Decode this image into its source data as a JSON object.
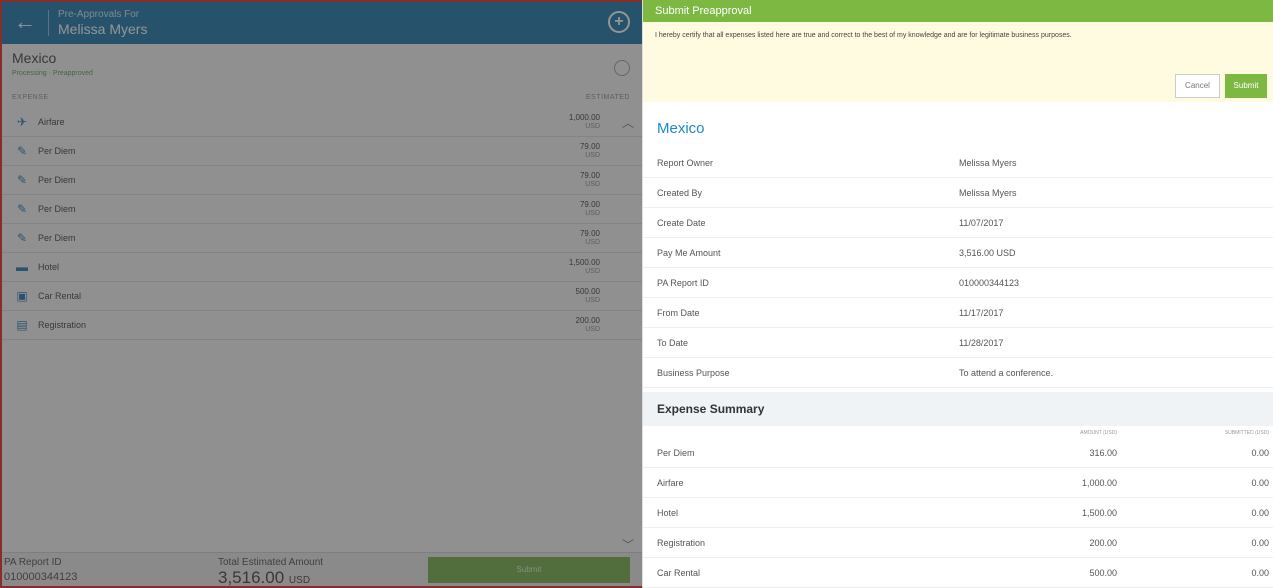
{
  "left": {
    "header": {
      "pre_label": "Pre-Approvals For",
      "name": "Melissa Myers"
    },
    "report": {
      "title": "Mexico",
      "status": "Processing · Preapproved"
    },
    "columns": {
      "expense": "EXPENSE",
      "estimated": "ESTIMATED"
    },
    "rows": [
      {
        "icon": "airplane-icon",
        "glyph": "✈",
        "label": "Airfare",
        "amount": "1,000.00",
        "currency": "USD"
      },
      {
        "icon": "per-diem-icon",
        "glyph": "✎",
        "label": "Per Diem",
        "amount": "79.00",
        "currency": "USD"
      },
      {
        "icon": "per-diem-icon",
        "glyph": "✎",
        "label": "Per Diem",
        "amount": "79.00",
        "currency": "USD"
      },
      {
        "icon": "per-diem-icon",
        "glyph": "✎",
        "label": "Per Diem",
        "amount": "79.00",
        "currency": "USD"
      },
      {
        "icon": "per-diem-icon",
        "glyph": "✎",
        "label": "Per Diem",
        "amount": "79.00",
        "currency": "USD"
      },
      {
        "icon": "bed-icon",
        "glyph": "▬",
        "label": "Hotel",
        "amount": "1,500.00",
        "currency": "USD"
      },
      {
        "icon": "car-icon",
        "glyph": "▣",
        "label": "Car Rental",
        "amount": "500.00",
        "currency": "USD"
      },
      {
        "icon": "registration-icon",
        "glyph": "▤",
        "label": "Registration",
        "amount": "200.00",
        "currency": "USD"
      }
    ],
    "footer": {
      "report_id_label": "PA Report ID",
      "report_id": "010000344123",
      "total_label": "Total Estimated Amount",
      "total": "3,516.00",
      "total_currency": "USD",
      "submit_label": "Submit"
    }
  },
  "right": {
    "bar_title": "Submit Preapproval",
    "certification": "I hereby certify that all expenses listed here are true and correct to the best of my knowledge and are for legitimate business purposes.",
    "cancel_label": "Cancel",
    "submit_label": "Submit",
    "report_title": "Mexico",
    "details": [
      {
        "key": "Report Owner",
        "value": "Melissa Myers"
      },
      {
        "key": "Created By",
        "value": "Melissa Myers"
      },
      {
        "key": "Create Date",
        "value": "11/07/2017"
      },
      {
        "key": "Pay Me Amount",
        "value": "3,516.00 USD"
      },
      {
        "key": "PA Report ID",
        "value": "010000344123"
      },
      {
        "key": "From Date",
        "value": "11/17/2017"
      },
      {
        "key": "To Date",
        "value": "11/28/2017"
      },
      {
        "key": "Business Purpose",
        "value": "To attend a conference."
      }
    ],
    "summary_title": "Expense Summary",
    "summary_cols": {
      "amount": "AMOUNT (USD)",
      "submitted": "SUBMITTED (USD)"
    },
    "summary": [
      {
        "key": "Per Diem",
        "amount": "316.00",
        "submitted": "0.00"
      },
      {
        "key": "Airfare",
        "amount": "1,000.00",
        "submitted": "0.00"
      },
      {
        "key": "Hotel",
        "amount": "1,500.00",
        "submitted": "0.00"
      },
      {
        "key": "Registration",
        "amount": "200.00",
        "submitted": "0.00"
      },
      {
        "key": "Car Rental",
        "amount": "500.00",
        "submitted": "0.00"
      }
    ]
  },
  "colors": {
    "header_blue": "#0f6ea5",
    "green": "#7db843",
    "link_blue": "#1a8bc7",
    "cert_yellow": "#fffbe0"
  }
}
